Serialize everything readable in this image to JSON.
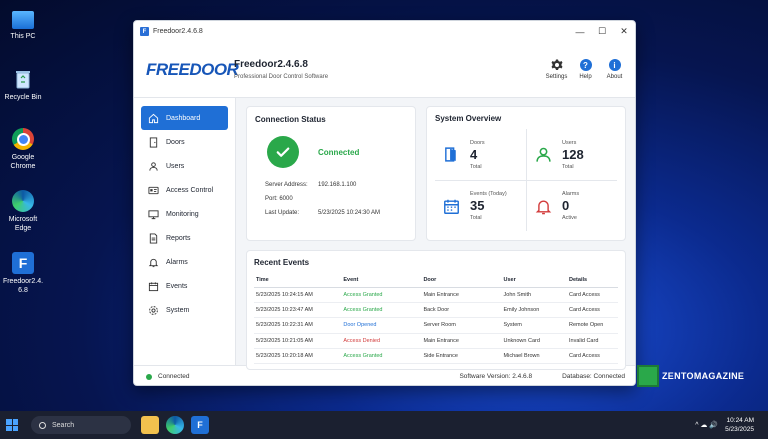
{
  "desktop": {
    "icons": [
      {
        "label": "This PC"
      },
      {
        "label": "Recycle Bin"
      },
      {
        "label": "Google Chrome"
      },
      {
        "label": "Microsoft Edge"
      },
      {
        "label": "Freedoor2.4.6.8"
      }
    ]
  },
  "window": {
    "title": "Freedoor2.4.6.8",
    "app_icon": "F",
    "controls": {
      "minimize": "—",
      "maximize": "☐",
      "close": "✕"
    }
  },
  "header": {
    "logo": "FREEDOOR",
    "app_name": "Freedoor2.4.6.8",
    "subtitle": "Professional Door Control Software",
    "buttons": [
      {
        "label": "Settings",
        "icon": "gear-icon"
      },
      {
        "label": "Help",
        "icon": "help-icon",
        "glyph": "?"
      },
      {
        "label": "About",
        "icon": "info-icon",
        "glyph": "i"
      }
    ]
  },
  "sidebar": {
    "items": [
      {
        "label": "Dashboard",
        "icon": "home-icon"
      },
      {
        "label": "Doors",
        "icon": "door-icon"
      },
      {
        "label": "Users",
        "icon": "user-icon"
      },
      {
        "label": "Access Control",
        "icon": "id-card-icon"
      },
      {
        "label": "Monitoring",
        "icon": "monitor-icon"
      },
      {
        "label": "Reports",
        "icon": "report-icon"
      },
      {
        "label": "Alarms",
        "icon": "bell-icon"
      },
      {
        "label": "Events",
        "icon": "calendar-icon"
      },
      {
        "label": "System",
        "icon": "gear-icon"
      }
    ],
    "active_index": 0
  },
  "connection": {
    "title": "Connection Status",
    "status": "Connected",
    "server_label": "Server Address:",
    "server_value": "192.168.1.100",
    "port_label": "Port: 6000",
    "update_label": "Last Update:",
    "update_value": "5/23/2025 10:24:30 AM"
  },
  "overview": {
    "title": "System Overview",
    "cells": [
      {
        "label": "Doors",
        "value": "4",
        "foot": "Total",
        "color": "#1f6fd6"
      },
      {
        "label": "Users",
        "value": "128",
        "foot": "Total",
        "color": "#2aa84a"
      },
      {
        "label": "Events (Today)",
        "value": "35",
        "foot": "Total",
        "color": "#1f6fd6"
      },
      {
        "label": "Alarms",
        "value": "0",
        "foot": "Active",
        "color": "#d23b3b"
      }
    ]
  },
  "events": {
    "title": "Recent Events",
    "columns": [
      "Time",
      "Event",
      "Door",
      "User",
      "Details"
    ],
    "rows": [
      {
        "time": "5/23/2025 10:24:15 AM",
        "event": "Access Granted",
        "kind": "green",
        "door": "Main Entrance",
        "user": "John Smith",
        "details": "Card Access"
      },
      {
        "time": "5/23/2025 10:23:47 AM",
        "event": "Access Granted",
        "kind": "green",
        "door": "Back Door",
        "user": "Emily Johnson",
        "details": "Card Access"
      },
      {
        "time": "5/23/2025 10:22:31 AM",
        "event": "Door Opened",
        "kind": "blue",
        "door": "Server Room",
        "user": "System",
        "details": "Remote Open"
      },
      {
        "time": "5/23/2025 10:21:05 AM",
        "event": "Access Denied",
        "kind": "red",
        "door": "Main Entrance",
        "user": "Unknown Card",
        "details": "Invalid Card"
      },
      {
        "time": "5/23/2025 10:20:18 AM",
        "event": "Access Granted",
        "kind": "green",
        "door": "Side Entrance",
        "user": "Michael Brown",
        "details": "Card Access"
      }
    ]
  },
  "statusbar": {
    "connection": "Connected",
    "version": "Software Version: 2.4.6.8",
    "database": "Database: Connected"
  },
  "watermark": {
    "text": "ZENTOMAGAZINE"
  },
  "taskbar": {
    "search_placeholder": "Search",
    "time": "10:24 AM",
    "date": "5/23/2025",
    "tray_symbols": "^  ☁  🔊"
  },
  "colors": {
    "accent": "#1f6fd6",
    "success": "#2aa84a",
    "danger": "#d23b3b"
  }
}
